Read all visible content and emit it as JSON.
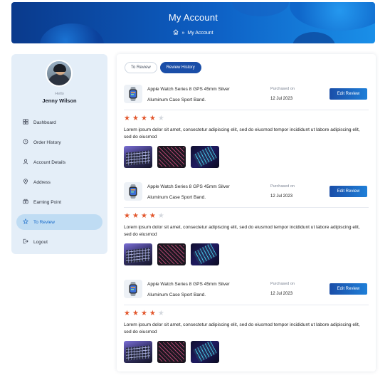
{
  "header": {
    "title": "My Account",
    "breadcrumb_icon": "home-icon",
    "breadcrumb_separator": "»",
    "breadcrumb_current": "My Account"
  },
  "sidebar": {
    "greeting": "Hello",
    "user_name": "Jenny Wilson",
    "items": [
      {
        "label": "Dashboard",
        "icon": "grid-icon"
      },
      {
        "label": "Order History",
        "icon": "history-icon"
      },
      {
        "label": "Account Details",
        "icon": "user-icon"
      },
      {
        "label": "Address",
        "icon": "location-pin-icon"
      },
      {
        "label": "Earning Point",
        "icon": "coins-icon"
      },
      {
        "label": "To Review",
        "icon": "star-icon",
        "active": true
      },
      {
        "label": "Logout",
        "icon": "logout-icon"
      }
    ]
  },
  "main": {
    "tabs": [
      {
        "label": "To Review",
        "active": false
      },
      {
        "label": "Review History",
        "active": true
      }
    ],
    "reviews": [
      {
        "product_line1": "Apple Watch Series 8 GPS 45mm Silver",
        "product_line2": "Aluminum Case Sport Band.",
        "purchased_label": "Purchased on",
        "purchased_date": "12 Jul 2023",
        "edit_label": "Edit Review",
        "rating": 4,
        "max_rating": 5,
        "text": "Lorem ipsum dolor sit amet, consectetur adipiscing elit, sed do eiusmod tempor incididunt ut labore adipiscing elit, sed do eiusmod"
      },
      {
        "product_line1": "Apple Watch Series 8 GPS 45mm Silver",
        "product_line2": "Aluminum Case Sport Band.",
        "purchased_label": "Purchased on",
        "purchased_date": "12 Jul 2023",
        "edit_label": "Edit Review",
        "rating": 4,
        "max_rating": 5,
        "text": "Lorem ipsum dolor sit amet, consectetur adipiscing elit, sed do eiusmod tempor incididunt ut labore adipiscing elit, sed do eiusmod"
      },
      {
        "product_line1": "Apple Watch Series 8 GPS 45mm Silver",
        "product_line2": "Aluminum Case Sport Band.",
        "purchased_label": "Purchased on",
        "purchased_date": "12 Jul 2023",
        "edit_label": "Edit Review",
        "rating": 4,
        "max_rating": 5,
        "text": "Lorem ipsum dolor sit amet, consectetur adipiscing elit, sed do eiusmod tempor incididunt ut labore adipiscing elit, sed do eiusmod"
      }
    ]
  },
  "colors": {
    "primary": "#1a4ea8",
    "accent": "#1f7fd8",
    "star": "#e2562c",
    "sidebar_bg": "#e4eef8",
    "active_item_bg": "#bfdcf3"
  }
}
